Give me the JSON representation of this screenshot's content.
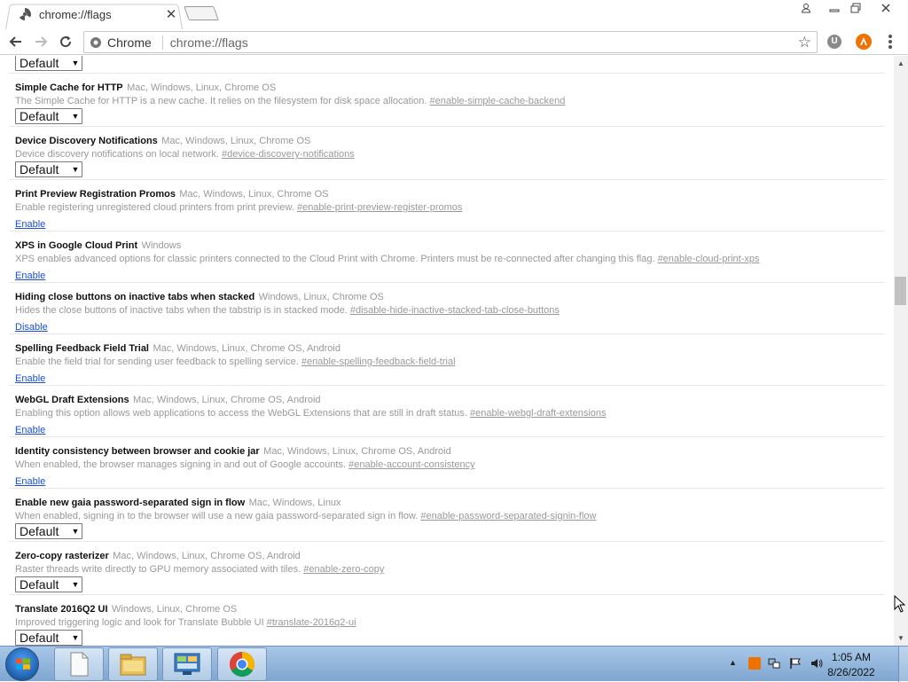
{
  "browser": {
    "tab": {
      "title": "chrome://flags",
      "close_label": "✕"
    },
    "omnibox": {
      "scheme_label": "Chrome",
      "url": "chrome://flags"
    },
    "extensions": {
      "u_label": "U"
    }
  },
  "flags": [
    {
      "name": "",
      "platforms": "",
      "description": "",
      "hash": "",
      "control": "select",
      "value": "Default",
      "partial": true
    },
    {
      "name": "Simple Cache for HTTP",
      "platforms": "Mac, Windows, Linux, Chrome OS",
      "description": "The Simple Cache for HTTP is a new cache. It relies on the filesystem for disk space allocation.",
      "hash": "#enable-simple-cache-backend",
      "control": "select",
      "value": "Default"
    },
    {
      "name": "Device Discovery Notifications",
      "platforms": "Mac, Windows, Linux, Chrome OS",
      "description": "Device discovery notifications on local network.",
      "hash": "#device-discovery-notifications",
      "control": "select",
      "value": "Default"
    },
    {
      "name": "Print Preview Registration Promos",
      "platforms": "Mac, Windows, Linux, Chrome OS",
      "description": "Enable registering unregistered cloud printers from print preview.",
      "hash": "#enable-print-preview-register-promos",
      "control": "link",
      "value": "Enable"
    },
    {
      "name": "XPS in Google Cloud Print",
      "platforms": "Windows",
      "description": "XPS enables advanced options for classic printers connected to the Cloud Print with Chrome. Printers must be re-connected after changing this flag.",
      "hash": "#enable-cloud-print-xps",
      "control": "link",
      "value": "Enable"
    },
    {
      "name": "Hiding close buttons on inactive tabs when stacked",
      "platforms": "Windows, Linux, Chrome OS",
      "description": "Hides the close buttons of inactive tabs when the tabstrip is in stacked mode.",
      "hash": "#disable-hide-inactive-stacked-tab-close-buttons",
      "control": "link",
      "value": "Disable"
    },
    {
      "name": "Spelling Feedback Field Trial",
      "platforms": "Mac, Windows, Linux, Chrome OS, Android",
      "description": "Enable the field trial for sending user feedback to spelling service.",
      "hash": "#enable-spelling-feedback-field-trial",
      "control": "link",
      "value": "Enable"
    },
    {
      "name": "WebGL Draft Extensions",
      "platforms": "Mac, Windows, Linux, Chrome OS, Android",
      "description": "Enabling this option allows web applications to access the WebGL Extensions that are still in draft status.",
      "hash": "#enable-webgl-draft-extensions",
      "control": "link",
      "value": "Enable"
    },
    {
      "name": "Identity consistency between browser and cookie jar",
      "platforms": "Mac, Windows, Linux, Chrome OS, Android",
      "description": "When enabled, the browser manages signing in and out of Google accounts.",
      "hash": "#enable-account-consistency",
      "control": "link",
      "value": "Enable"
    },
    {
      "name": "Enable new gaia password-separated sign in flow",
      "platforms": "Mac, Windows, Linux",
      "description": "When enabled, signing in to the browser will use a new gaia password-separated sign in flow.",
      "hash": "#enable-password-separated-signin-flow",
      "control": "select",
      "value": "Default"
    },
    {
      "name": "Zero-copy rasterizer",
      "platforms": "Mac, Windows, Linux, Chrome OS, Android",
      "description": "Raster threads write directly to GPU memory associated with tiles.",
      "hash": "#enable-zero-copy",
      "control": "select",
      "value": "Default"
    },
    {
      "name": "Translate 2016Q2 UI",
      "platforms": "Windows, Linux, Chrome OS",
      "description": "Improved triggering logic and look for Translate Bubble UI",
      "hash": "#translate-2016q2-ui",
      "control": "select",
      "value": "Default"
    }
  ],
  "taskbar": {
    "clock_time": "1:05 AM",
    "clock_date": "8/26/2022"
  },
  "colors": {
    "link": "#1a4ed8",
    "muted": "#999999",
    "accent_avast": "#ee7200"
  }
}
